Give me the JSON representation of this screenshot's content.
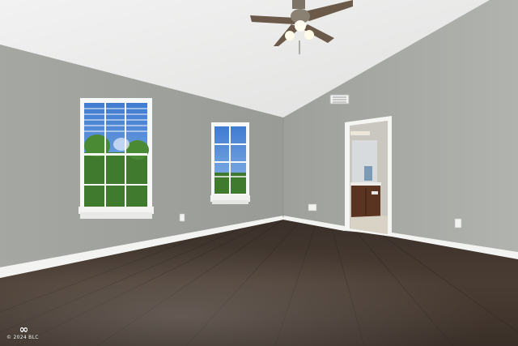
{
  "watermark": {
    "symbol": "∞",
    "text": "© 2024 BLC"
  },
  "colors": {
    "left_wall": "#9c9e9a",
    "right_wall": "#a8aaa5",
    "ceiling": "#ececec",
    "floor": "#3b3029",
    "baseboard": "#f3f3f1",
    "window_frame": "#f7f7f7",
    "sky": "#4a86d6",
    "trees": "#3f7a2e",
    "vanity": "#5a3421",
    "fan_blade": "#6b5a4a"
  }
}
